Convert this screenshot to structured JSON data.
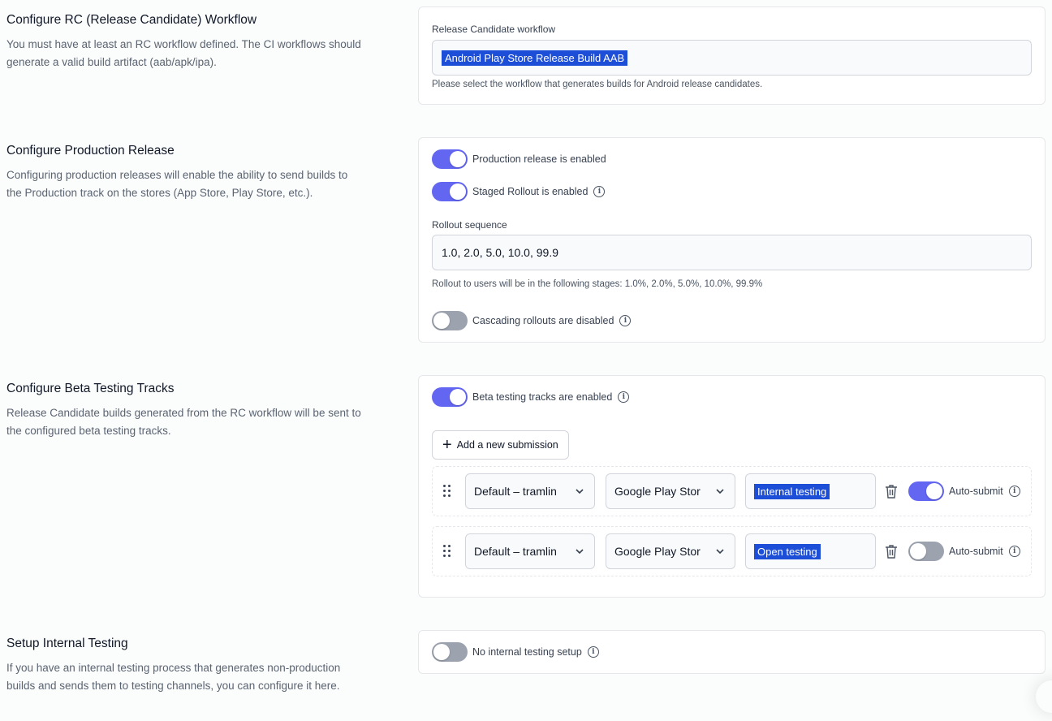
{
  "rc_workflow": {
    "title": "Configure RC (Release Candidate) Workflow",
    "description": "You must have at least an RC workflow defined. The CI workflows should generate a valid build artifact (aab/apk/ipa).",
    "field_label": "Release Candidate workflow",
    "selected_workflow": "Android Play Store Release Build AAB",
    "help": "Please select the workflow that generates builds for Android release candidates."
  },
  "production": {
    "title": "Configure Production Release",
    "description": "Configuring production releases will enable the ability to send builds to the Production track on the stores (App Store, Play Store, etc.).",
    "production_toggle": {
      "label": "Production release is enabled",
      "on": true
    },
    "staged_toggle": {
      "label": "Staged Rollout is enabled",
      "on": true
    },
    "rollout_label": "Rollout sequence",
    "rollout_value": "1.0, 2.0, 5.0, 10.0, 99.9",
    "rollout_help": "Rollout to users will be in the following stages: 1.0%, 2.0%, 5.0%, 10.0%, 99.9%",
    "cascading_toggle": {
      "label": "Cascading rollouts are disabled",
      "on": false
    }
  },
  "beta": {
    "title": "Configure Beta Testing Tracks",
    "description": "Release Candidate builds generated from the RC workflow will be sent to the configured beta testing tracks.",
    "beta_toggle": {
      "label": "Beta testing tracks are enabled",
      "on": true
    },
    "add_button": "Add a new submission",
    "submissions": [
      {
        "integration": "Default – tramlin",
        "store": "Google Play Stor",
        "track": "Internal testing",
        "auto_submit_label": "Auto-submit",
        "auto_submit": true
      },
      {
        "integration": "Default – tramlin",
        "store": "Google Play Stor",
        "track": "Open testing",
        "auto_submit_label": "Auto-submit",
        "auto_submit": false
      }
    ]
  },
  "internal": {
    "title": "Setup Internal Testing",
    "description": "If you have an internal testing process that generates non-production builds and sends them to testing channels, you can configure it here.",
    "internal_toggle": {
      "label": "No internal testing setup",
      "on": false
    }
  }
}
